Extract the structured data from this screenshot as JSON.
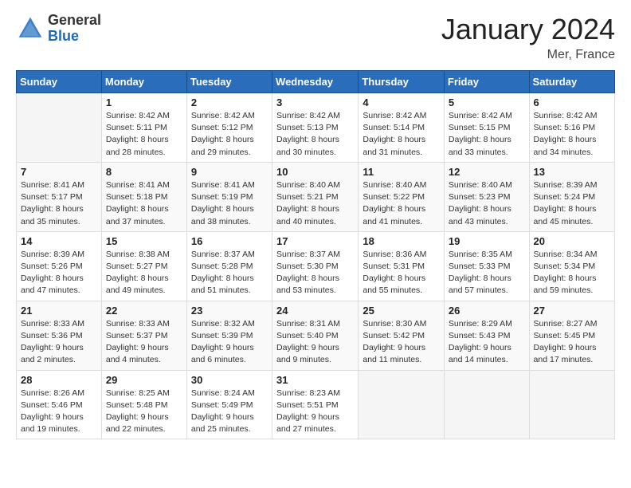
{
  "logo": {
    "line1": "General",
    "line2": "Blue"
  },
  "title": "January 2024",
  "location": "Mer, France",
  "days_header": [
    "Sunday",
    "Monday",
    "Tuesday",
    "Wednesday",
    "Thursday",
    "Friday",
    "Saturday"
  ],
  "weeks": [
    [
      {
        "day": "",
        "info": ""
      },
      {
        "day": "1",
        "info": "Sunrise: 8:42 AM\nSunset: 5:11 PM\nDaylight: 8 hours\nand 28 minutes."
      },
      {
        "day": "2",
        "info": "Sunrise: 8:42 AM\nSunset: 5:12 PM\nDaylight: 8 hours\nand 29 minutes."
      },
      {
        "day": "3",
        "info": "Sunrise: 8:42 AM\nSunset: 5:13 PM\nDaylight: 8 hours\nand 30 minutes."
      },
      {
        "day": "4",
        "info": "Sunrise: 8:42 AM\nSunset: 5:14 PM\nDaylight: 8 hours\nand 31 minutes."
      },
      {
        "day": "5",
        "info": "Sunrise: 8:42 AM\nSunset: 5:15 PM\nDaylight: 8 hours\nand 33 minutes."
      },
      {
        "day": "6",
        "info": "Sunrise: 8:42 AM\nSunset: 5:16 PM\nDaylight: 8 hours\nand 34 minutes."
      }
    ],
    [
      {
        "day": "7",
        "info": "Sunrise: 8:41 AM\nSunset: 5:17 PM\nDaylight: 8 hours\nand 35 minutes."
      },
      {
        "day": "8",
        "info": "Sunrise: 8:41 AM\nSunset: 5:18 PM\nDaylight: 8 hours\nand 37 minutes."
      },
      {
        "day": "9",
        "info": "Sunrise: 8:41 AM\nSunset: 5:19 PM\nDaylight: 8 hours\nand 38 minutes."
      },
      {
        "day": "10",
        "info": "Sunrise: 8:40 AM\nSunset: 5:21 PM\nDaylight: 8 hours\nand 40 minutes."
      },
      {
        "day": "11",
        "info": "Sunrise: 8:40 AM\nSunset: 5:22 PM\nDaylight: 8 hours\nand 41 minutes."
      },
      {
        "day": "12",
        "info": "Sunrise: 8:40 AM\nSunset: 5:23 PM\nDaylight: 8 hours\nand 43 minutes."
      },
      {
        "day": "13",
        "info": "Sunrise: 8:39 AM\nSunset: 5:24 PM\nDaylight: 8 hours\nand 45 minutes."
      }
    ],
    [
      {
        "day": "14",
        "info": "Sunrise: 8:39 AM\nSunset: 5:26 PM\nDaylight: 8 hours\nand 47 minutes."
      },
      {
        "day": "15",
        "info": "Sunrise: 8:38 AM\nSunset: 5:27 PM\nDaylight: 8 hours\nand 49 minutes."
      },
      {
        "day": "16",
        "info": "Sunrise: 8:37 AM\nSunset: 5:28 PM\nDaylight: 8 hours\nand 51 minutes."
      },
      {
        "day": "17",
        "info": "Sunrise: 8:37 AM\nSunset: 5:30 PM\nDaylight: 8 hours\nand 53 minutes."
      },
      {
        "day": "18",
        "info": "Sunrise: 8:36 AM\nSunset: 5:31 PM\nDaylight: 8 hours\nand 55 minutes."
      },
      {
        "day": "19",
        "info": "Sunrise: 8:35 AM\nSunset: 5:33 PM\nDaylight: 8 hours\nand 57 minutes."
      },
      {
        "day": "20",
        "info": "Sunrise: 8:34 AM\nSunset: 5:34 PM\nDaylight: 8 hours\nand 59 minutes."
      }
    ],
    [
      {
        "day": "21",
        "info": "Sunrise: 8:33 AM\nSunset: 5:36 PM\nDaylight: 9 hours\nand 2 minutes."
      },
      {
        "day": "22",
        "info": "Sunrise: 8:33 AM\nSunset: 5:37 PM\nDaylight: 9 hours\nand 4 minutes."
      },
      {
        "day": "23",
        "info": "Sunrise: 8:32 AM\nSunset: 5:39 PM\nDaylight: 9 hours\nand 6 minutes."
      },
      {
        "day": "24",
        "info": "Sunrise: 8:31 AM\nSunset: 5:40 PM\nDaylight: 9 hours\nand 9 minutes."
      },
      {
        "day": "25",
        "info": "Sunrise: 8:30 AM\nSunset: 5:42 PM\nDaylight: 9 hours\nand 11 minutes."
      },
      {
        "day": "26",
        "info": "Sunrise: 8:29 AM\nSunset: 5:43 PM\nDaylight: 9 hours\nand 14 minutes."
      },
      {
        "day": "27",
        "info": "Sunrise: 8:27 AM\nSunset: 5:45 PM\nDaylight: 9 hours\nand 17 minutes."
      }
    ],
    [
      {
        "day": "28",
        "info": "Sunrise: 8:26 AM\nSunset: 5:46 PM\nDaylight: 9 hours\nand 19 minutes."
      },
      {
        "day": "29",
        "info": "Sunrise: 8:25 AM\nSunset: 5:48 PM\nDaylight: 9 hours\nand 22 minutes."
      },
      {
        "day": "30",
        "info": "Sunrise: 8:24 AM\nSunset: 5:49 PM\nDaylight: 9 hours\nand 25 minutes."
      },
      {
        "day": "31",
        "info": "Sunrise: 8:23 AM\nSunset: 5:51 PM\nDaylight: 9 hours\nand 27 minutes."
      },
      {
        "day": "",
        "info": ""
      },
      {
        "day": "",
        "info": ""
      },
      {
        "day": "",
        "info": ""
      }
    ]
  ]
}
